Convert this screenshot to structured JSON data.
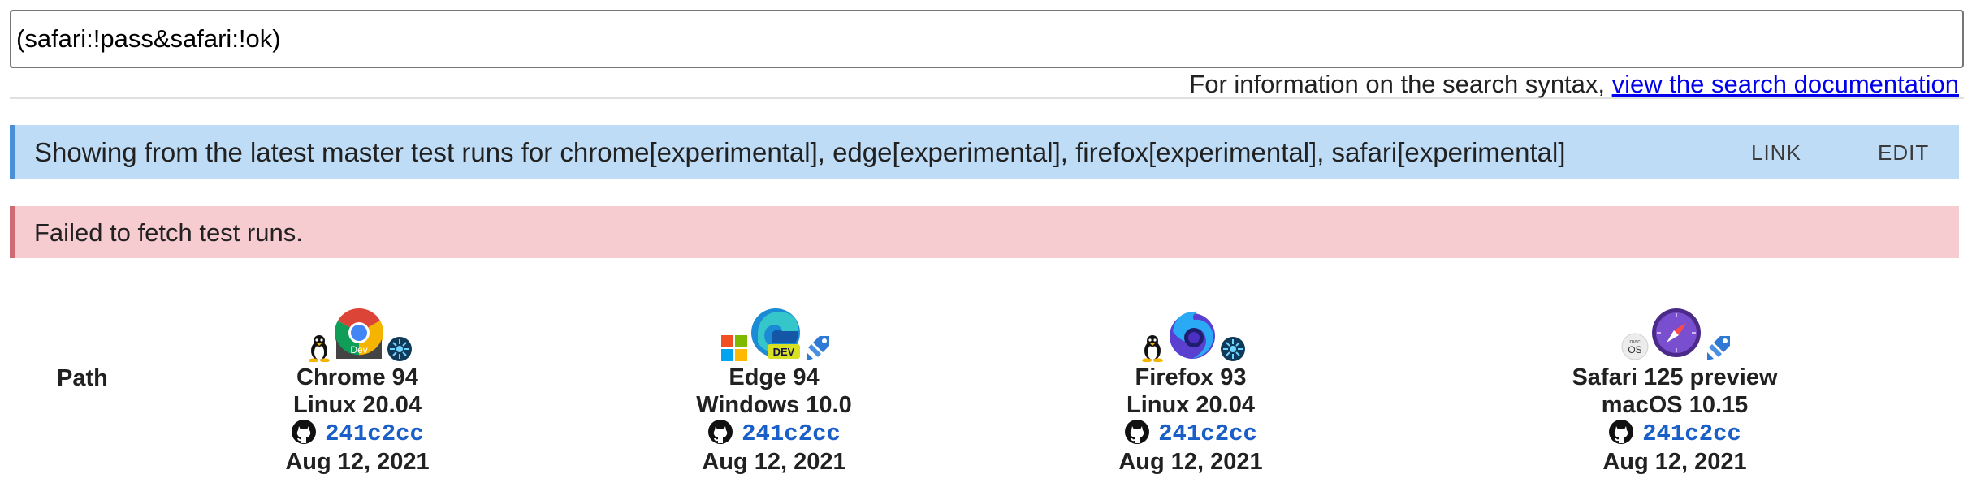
{
  "search": {
    "value": "(safari:!pass&safari:!ok)"
  },
  "syntax_help": {
    "prefix": "For information on the search syntax, ",
    "link_text": "view the search documentation"
  },
  "info_banner": {
    "text": "Showing from the latest master test runs for chrome[experimental], edge[experimental], firefox[experimental], safari[experimental]",
    "link_label": "LINK",
    "edit_label": "EDIT"
  },
  "error_banner": {
    "text": "Failed to fetch test runs."
  },
  "table": {
    "path_header": "Path"
  },
  "runs": [
    {
      "browser": "Chrome 94",
      "os": "Linux 20.04",
      "sha": "241c2cc",
      "date": "Aug 12, 2021",
      "icons": [
        "linux-icon",
        "chrome-dev-icon",
        "azure-icon"
      ]
    },
    {
      "browser": "Edge 94",
      "os": "Windows 10.0",
      "sha": "241c2cc",
      "date": "Aug 12, 2021",
      "icons": [
        "windows-icon",
        "edge-dev-icon",
        "azure-pipelines-icon"
      ]
    },
    {
      "browser": "Firefox 93",
      "os": "Linux 20.04",
      "sha": "241c2cc",
      "date": "Aug 12, 2021",
      "icons": [
        "linux-icon",
        "firefox-nightly-icon",
        "azure-icon"
      ]
    },
    {
      "browser": "Safari 125 preview",
      "os": "macOS 10.15",
      "sha": "241c2cc",
      "date": "Aug 12, 2021",
      "icons": [
        "macos-icon",
        "safari-preview-icon",
        "azure-pipelines-icon"
      ]
    }
  ],
  "icon_text": {
    "dev": "Dev",
    "edge_dev": "DEV",
    "os": "OS",
    "mac": "mac"
  }
}
